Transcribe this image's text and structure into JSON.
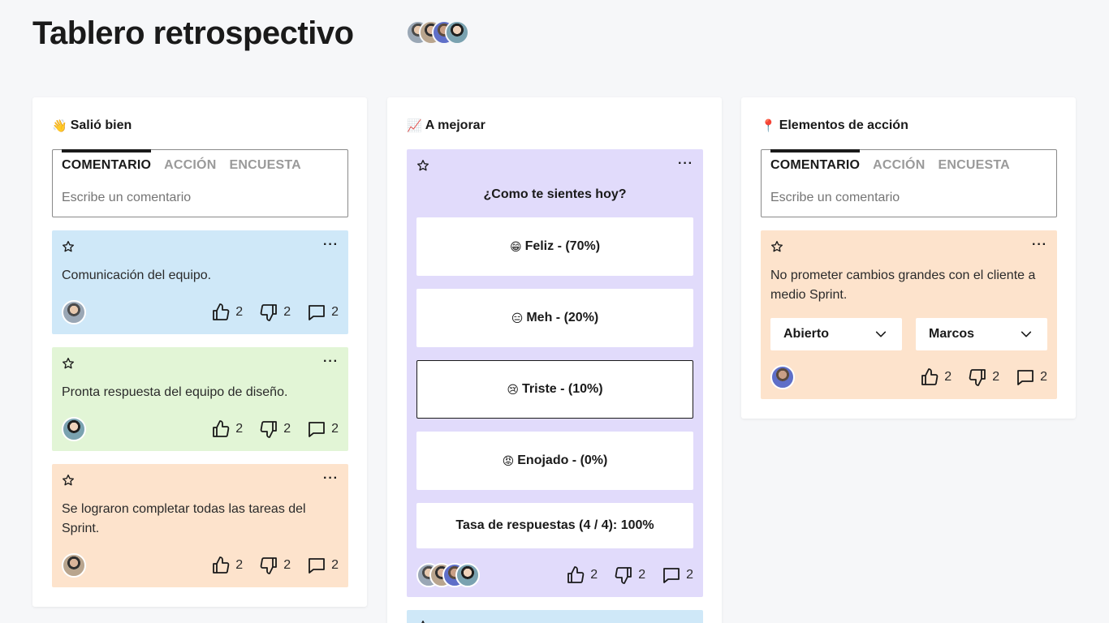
{
  "page_title": "Tablero retrospectivo",
  "colors": {
    "background": "#f6f7f9",
    "card_blue": "#cfe8f8",
    "card_green": "#e2f5d6",
    "card_orange": "#fde3cc",
    "card_purple": "#e1dbfb"
  },
  "composer_tabs": [
    "COMENTARIO",
    "ACCIÓN",
    "ENCUESTA"
  ],
  "composer_placeholder": "Escribe un comentario",
  "columns": [
    {
      "emoji": "👋",
      "title": "Salió bien",
      "cards": [
        {
          "text": "Comunicación del equipo.",
          "likes": "2",
          "dislikes": "2",
          "comments": "2"
        },
        {
          "text": "Pronta respuesta del equipo de diseño.",
          "likes": "2",
          "dislikes": "2",
          "comments": "2"
        },
        {
          "text": "Se lograron completar todas las tareas del Sprint.",
          "likes": "2",
          "dislikes": "2",
          "comments": "2"
        }
      ]
    },
    {
      "emoji": "📈",
      "title": "A mejorar",
      "poll": {
        "question": "¿Como te sientes hoy?",
        "options": [
          {
            "emoji": "😁",
            "label": "Feliz - (70%)",
            "percent": 70
          },
          {
            "emoji": "😑",
            "label": "Meh - (20%)",
            "percent": 20
          },
          {
            "emoji": "😢",
            "label": "Triste - (10%)",
            "percent": 10,
            "selected": true
          },
          {
            "emoji": "😡",
            "label": "Enojado - (0%)",
            "percent": 0
          }
        ],
        "response_rate": "Tasa de respuestas (4 / 4): 100%",
        "likes": "2",
        "dislikes": "2",
        "comments": "2"
      }
    },
    {
      "emoji": "📍",
      "title": "Elementos de acción",
      "cards": [
        {
          "text": "No prometer cambios grandes con el cliente a medio Sprint.",
          "status": "Abierto",
          "assignee": "Marcos",
          "likes": "2",
          "dislikes": "2",
          "comments": "2"
        }
      ]
    }
  ],
  "icons": [
    "star-icon",
    "more-icon",
    "thumbs-up-icon",
    "thumbs-down-icon",
    "comment-icon",
    "chevron-down-icon",
    "avatar"
  ]
}
